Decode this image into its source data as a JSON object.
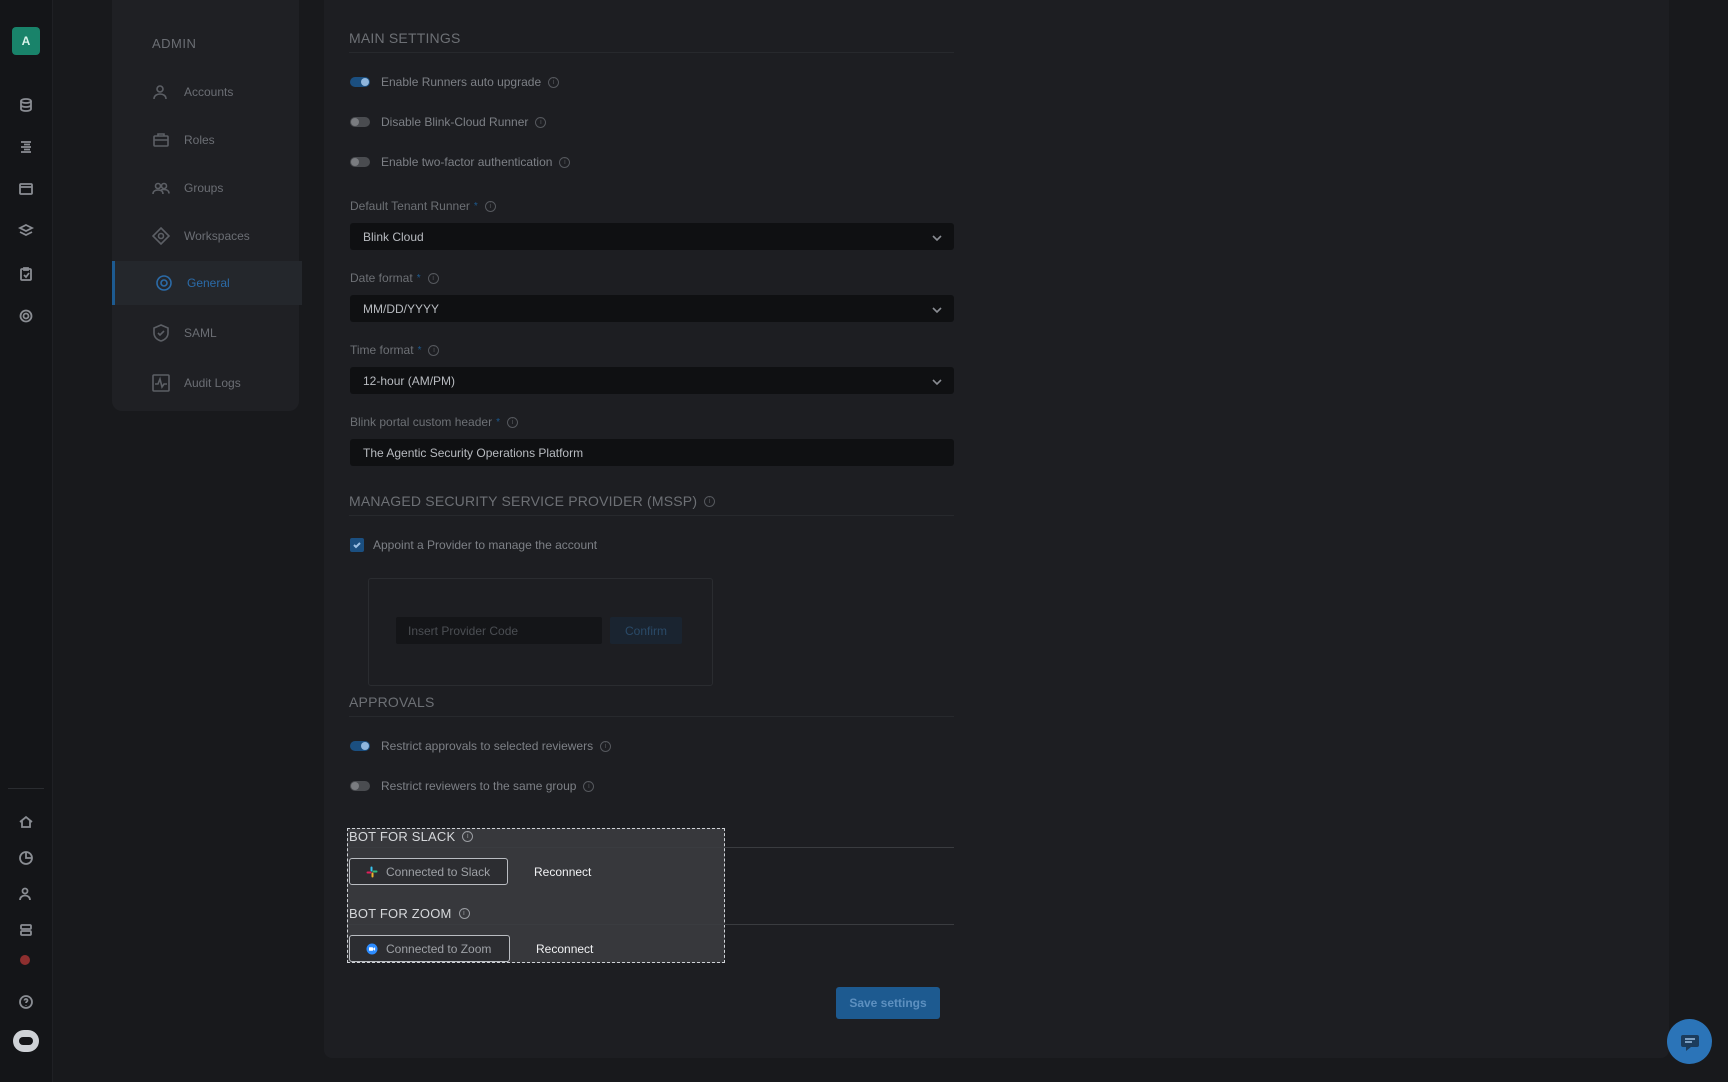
{
  "app": {
    "logo_letter": "A",
    "accent_color": "#1d5a90"
  },
  "rail": {
    "icons": [
      "database-icon",
      "list-icon",
      "calendar-icon",
      "layers-icon",
      "clipboard-icon",
      "gear-icon",
      "home-icon",
      "chart-icon",
      "users-icon",
      "server-icon",
      "notification-icon",
      "help-icon",
      "bot-icon"
    ]
  },
  "sidebar": {
    "heading": "ADMIN",
    "items": [
      {
        "label": "Accounts",
        "icon": "user-icon"
      },
      {
        "label": "Roles",
        "icon": "briefcase-icon"
      },
      {
        "label": "Groups",
        "icon": "group-icon"
      },
      {
        "label": "Workspaces",
        "icon": "diamond-icon"
      },
      {
        "label": "General",
        "icon": "gear-icon",
        "active": true
      },
      {
        "label": "SAML",
        "icon": "shield-icon"
      },
      {
        "label": "Audit Logs",
        "icon": "pulse-icon"
      }
    ]
  },
  "main_settings": {
    "title": "MAIN SETTINGS",
    "toggles": [
      {
        "label": "Enable Runners auto upgrade",
        "on": true
      },
      {
        "label": "Disable Blink-Cloud Runner",
        "on": false
      },
      {
        "label": "Enable two-factor authentication",
        "on": false
      }
    ],
    "default_runner": {
      "label": "Default Tenant Runner",
      "value": "Blink Cloud"
    },
    "date_format": {
      "label": "Date format",
      "value": "MM/DD/YYYY"
    },
    "time_format": {
      "label": "Time format",
      "value": "12-hour (AM/PM)"
    },
    "custom_header": {
      "label": "Blink portal custom header",
      "value": "The Agentic Security Operations Platform"
    },
    "required_mark": "*",
    "info_mark": "i"
  },
  "mssp": {
    "title": "MANAGED SECURITY SERVICE PROVIDER (MSSP)",
    "checkbox_label": "Appoint a Provider to manage the account",
    "checked": true,
    "input_placeholder": "Insert Provider Code",
    "confirm_label": "Confirm"
  },
  "approvals": {
    "title": "APPROVALS",
    "toggles": [
      {
        "label": "Restrict approvals to selected reviewers",
        "on": true
      },
      {
        "label": "Restrict reviewers to the same group",
        "on": false
      }
    ]
  },
  "slack": {
    "title": "BOT FOR SLACK",
    "status_label": "Connected to Slack",
    "reconnect_label": "Reconnect"
  },
  "zoom": {
    "title": "BOT FOR ZOOM",
    "status_label": "Connected to Zoom",
    "reconnect_label": "Reconnect"
  },
  "footer": {
    "save_label": "Save settings"
  }
}
